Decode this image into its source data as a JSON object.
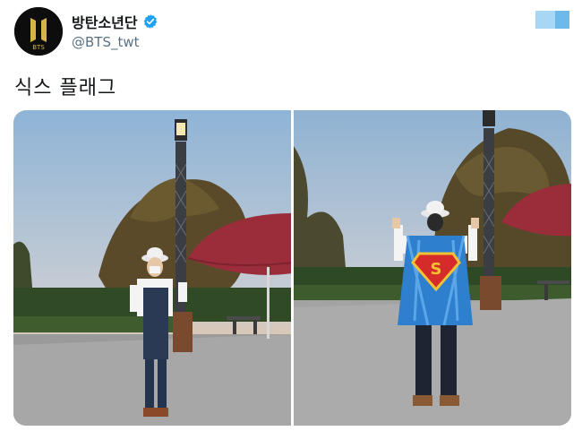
{
  "header": {
    "display_name": "방탄소년단",
    "handle": "@BTS_twt",
    "verified": true,
    "avatar_text": "BTS",
    "accent_color": "#1da1f2"
  },
  "tweet": {
    "text": "식스 플래그"
  },
  "media": [
    {
      "name": "photo-left"
    },
    {
      "name": "photo-right",
      "shirt_logo": "S"
    }
  ]
}
